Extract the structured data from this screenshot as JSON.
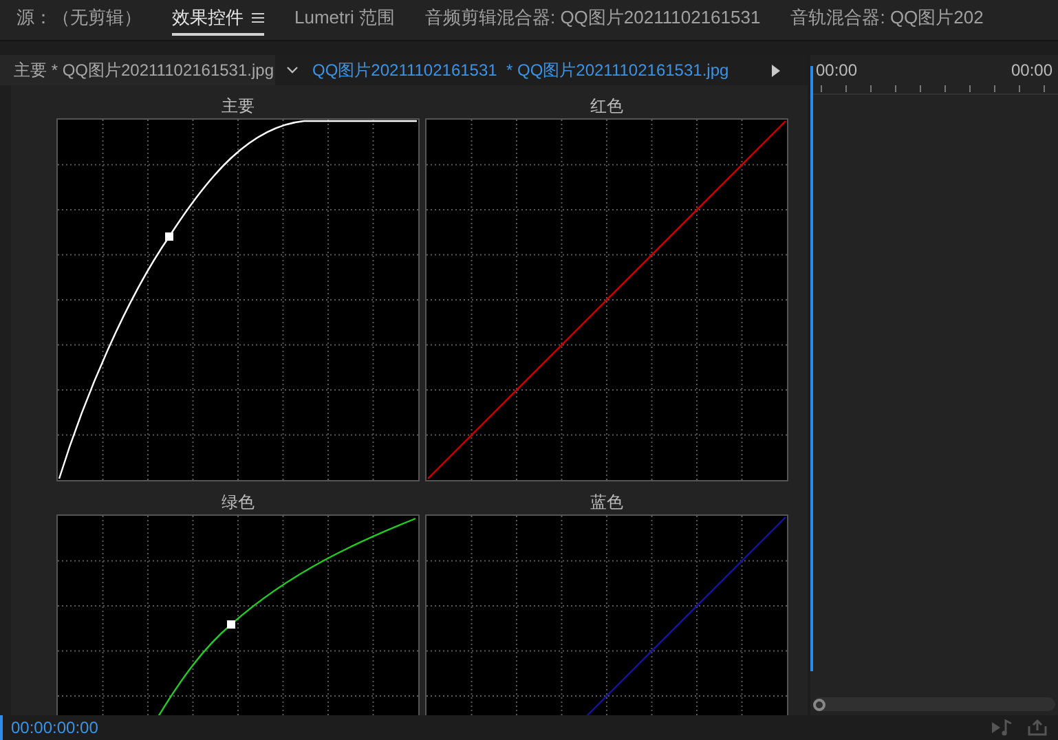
{
  "panel_tabs": [
    {
      "label": "源：（无剪辑）",
      "selected": false
    },
    {
      "label": "效果控件",
      "selected": true
    },
    {
      "label": "Lumetri 范围",
      "selected": false
    },
    {
      "label": "音频剪辑混合器: QQ图片20211102161531",
      "selected": false
    },
    {
      "label": "音轨混合器: QQ图片202",
      "selected": false
    }
  ],
  "clip_bar": {
    "master_clip": "主要 * QQ图片20211102161531.jpg",
    "sequence_clip": "QQ图片20211102161531  * QQ图片20211102161531.jpg"
  },
  "timeline": {
    "start": "00:00",
    "end": "00:00"
  },
  "curves": [
    {
      "title": "主要",
      "color": "#ffffff",
      "kind": "master"
    },
    {
      "title": "红色",
      "color": "#cc0000",
      "kind": "linear"
    },
    {
      "title": "绿色",
      "color": "#22cc22",
      "kind": "bent"
    },
    {
      "title": "蓝色",
      "color": "#1414a0",
      "kind": "linear"
    }
  ],
  "footer": {
    "timecode": "00:00:00:00"
  }
}
